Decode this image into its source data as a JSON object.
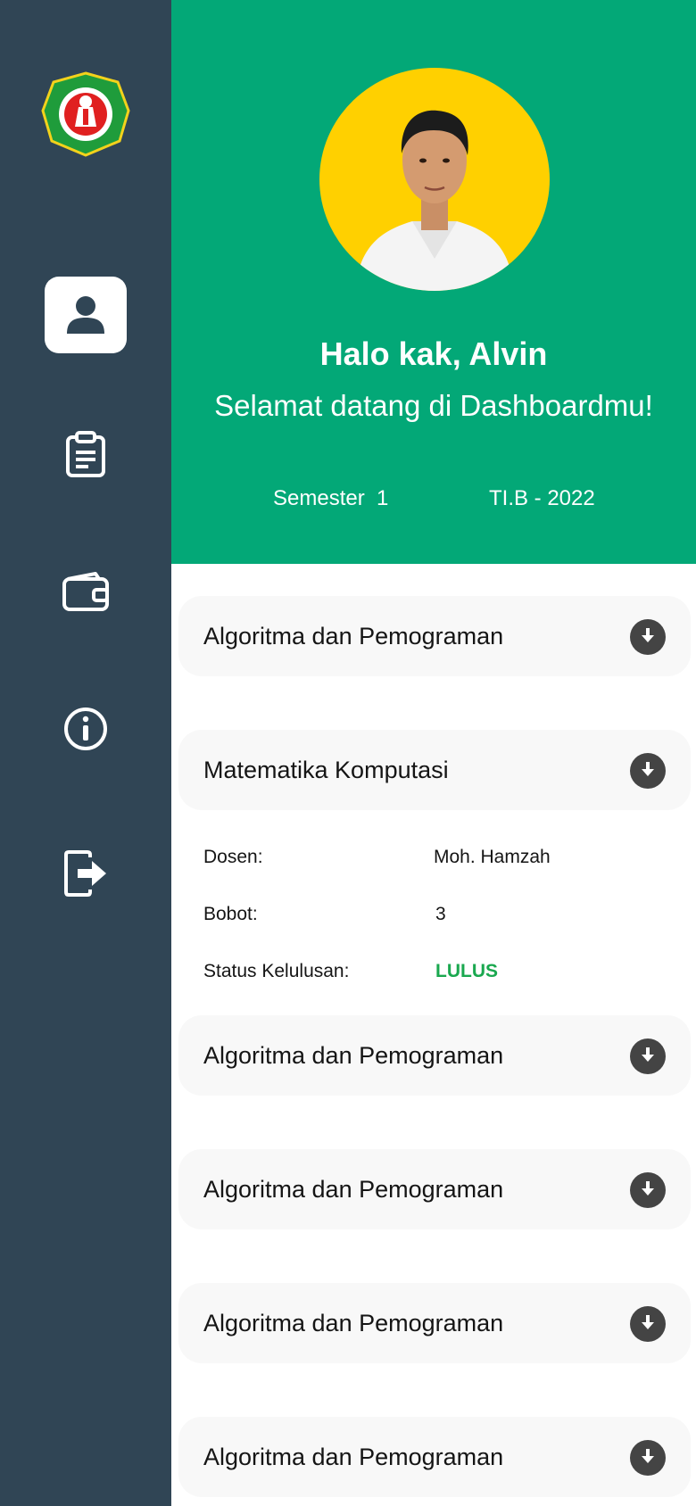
{
  "sidebar": {
    "logo": {
      "ring_text": "UNIVERSITAS ISLAM MADURA",
      "bottom_text": "PAMEKASAN"
    },
    "items": [
      {
        "icon": "user-icon",
        "active": true
      },
      {
        "icon": "clipboard-icon",
        "active": false
      },
      {
        "icon": "wallet-icon",
        "active": false
      },
      {
        "icon": "info-icon",
        "active": false
      },
      {
        "icon": "logout-icon",
        "active": false
      }
    ]
  },
  "header": {
    "greeting": "Halo kak, Alvin",
    "subtitle": "Selamat datang di Dashboardmu!",
    "semester": "Semester  1",
    "class": "TI.B - 2022"
  },
  "courses": [
    {
      "title": "Algoritma dan Pemograman",
      "expanded": false
    },
    {
      "title": "Matematika Komputasi",
      "expanded": true
    },
    {
      "title": "Algoritma dan Pemograman",
      "expanded": false
    },
    {
      "title": "Algoritma dan Pemograman",
      "expanded": false
    },
    {
      "title": "Algoritma dan Pemograman",
      "expanded": false
    },
    {
      "title": "Algoritma dan Pemograman",
      "expanded": false
    }
  ],
  "course_detail": {
    "lecturer_label": "Dosen:",
    "lecturer": "Moh. Hamzah",
    "weight_label": "Bobot:",
    "weight": "3",
    "status_label": "Status Kelulusan:",
    "status": "LULUS"
  },
  "colors": {
    "sidebar": "#304555",
    "header": "#03a877",
    "avatar_bg": "#ffd000",
    "status_pass": "#1aa84f",
    "card": "#f8f8f8"
  }
}
